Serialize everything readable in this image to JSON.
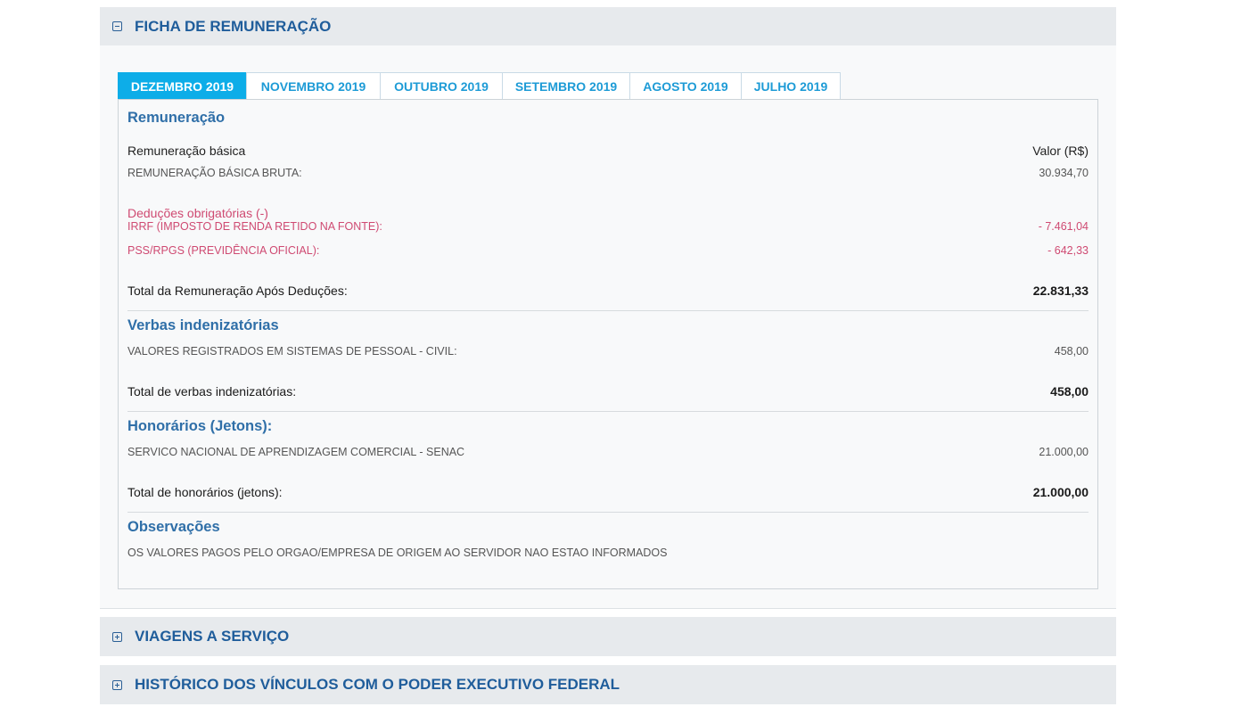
{
  "sections": {
    "ficha": {
      "title": "FICHA DE REMUNERAÇÃO"
    },
    "viagens": {
      "title": "VIAGENS A SERVIÇO"
    },
    "historico": {
      "title": "HISTÓRICO DOS VÍNCULOS COM O PODER EXECUTIVO FEDERAL"
    }
  },
  "tabs": [
    {
      "label": "DEZEMBRO 2019",
      "active": true
    },
    {
      "label": "NOVEMBRO 2019"
    },
    {
      "label": "OUTUBRO 2019"
    },
    {
      "label": "SETEMBRO 2019"
    },
    {
      "label": "AGOSTO 2019"
    },
    {
      "label": "JULHO 2019"
    }
  ],
  "remuneracao": {
    "title": "Remuneração",
    "col_left": "Remuneração básica",
    "col_right": "Valor (R$)",
    "basica": {
      "label": "REMUNERAÇÃO BÁSICA BRUTA:",
      "value": "30.934,70"
    },
    "deducoes_title": "Deduções obrigatórias (-)",
    "irrf": {
      "label": "IRRF (IMPOSTO DE RENDA RETIDO NA FONTE):",
      "value": "- 7.461,04"
    },
    "pss": {
      "label": "PSS/RPGS (PREVIDÊNCIA OFICIAL):",
      "value": "- 642,33"
    },
    "total": {
      "label": "Total da Remuneração Após Deduções:",
      "value": "22.831,33"
    }
  },
  "verbas": {
    "title": "Verbas indenizatórias",
    "item": {
      "label": "VALORES REGISTRADOS EM SISTEMAS DE PESSOAL - CIVIL:",
      "value": "458,00"
    },
    "total": {
      "label": "Total de verbas indenizatórias:",
      "value": "458,00"
    }
  },
  "honorarios": {
    "title": "Honorários (Jetons):",
    "item": {
      "label": "SERVICO NACIONAL DE APRENDIZAGEM COMERCIAL - SENAC",
      "value": "21.000,00"
    },
    "total": {
      "label": "Total de honorários (jetons):",
      "value": "21.000,00"
    }
  },
  "observacoes": {
    "title": "Observações",
    "text": "OS VALORES PAGOS PELO ORGAO/EMPRESA DE ORIGEM AO SERVIDOR NAO ESTAO INFORMADOS"
  },
  "colors": {
    "header_bg": "#e7eaed",
    "title_blue": "#1f5d9b",
    "tab_active": "#0dade8",
    "tab_text": "#1d9bd6",
    "deduction_red": "#cf4a72"
  },
  "icons": {
    "expanded": "minus-square-icon",
    "collapsed": "plus-square-icon"
  }
}
